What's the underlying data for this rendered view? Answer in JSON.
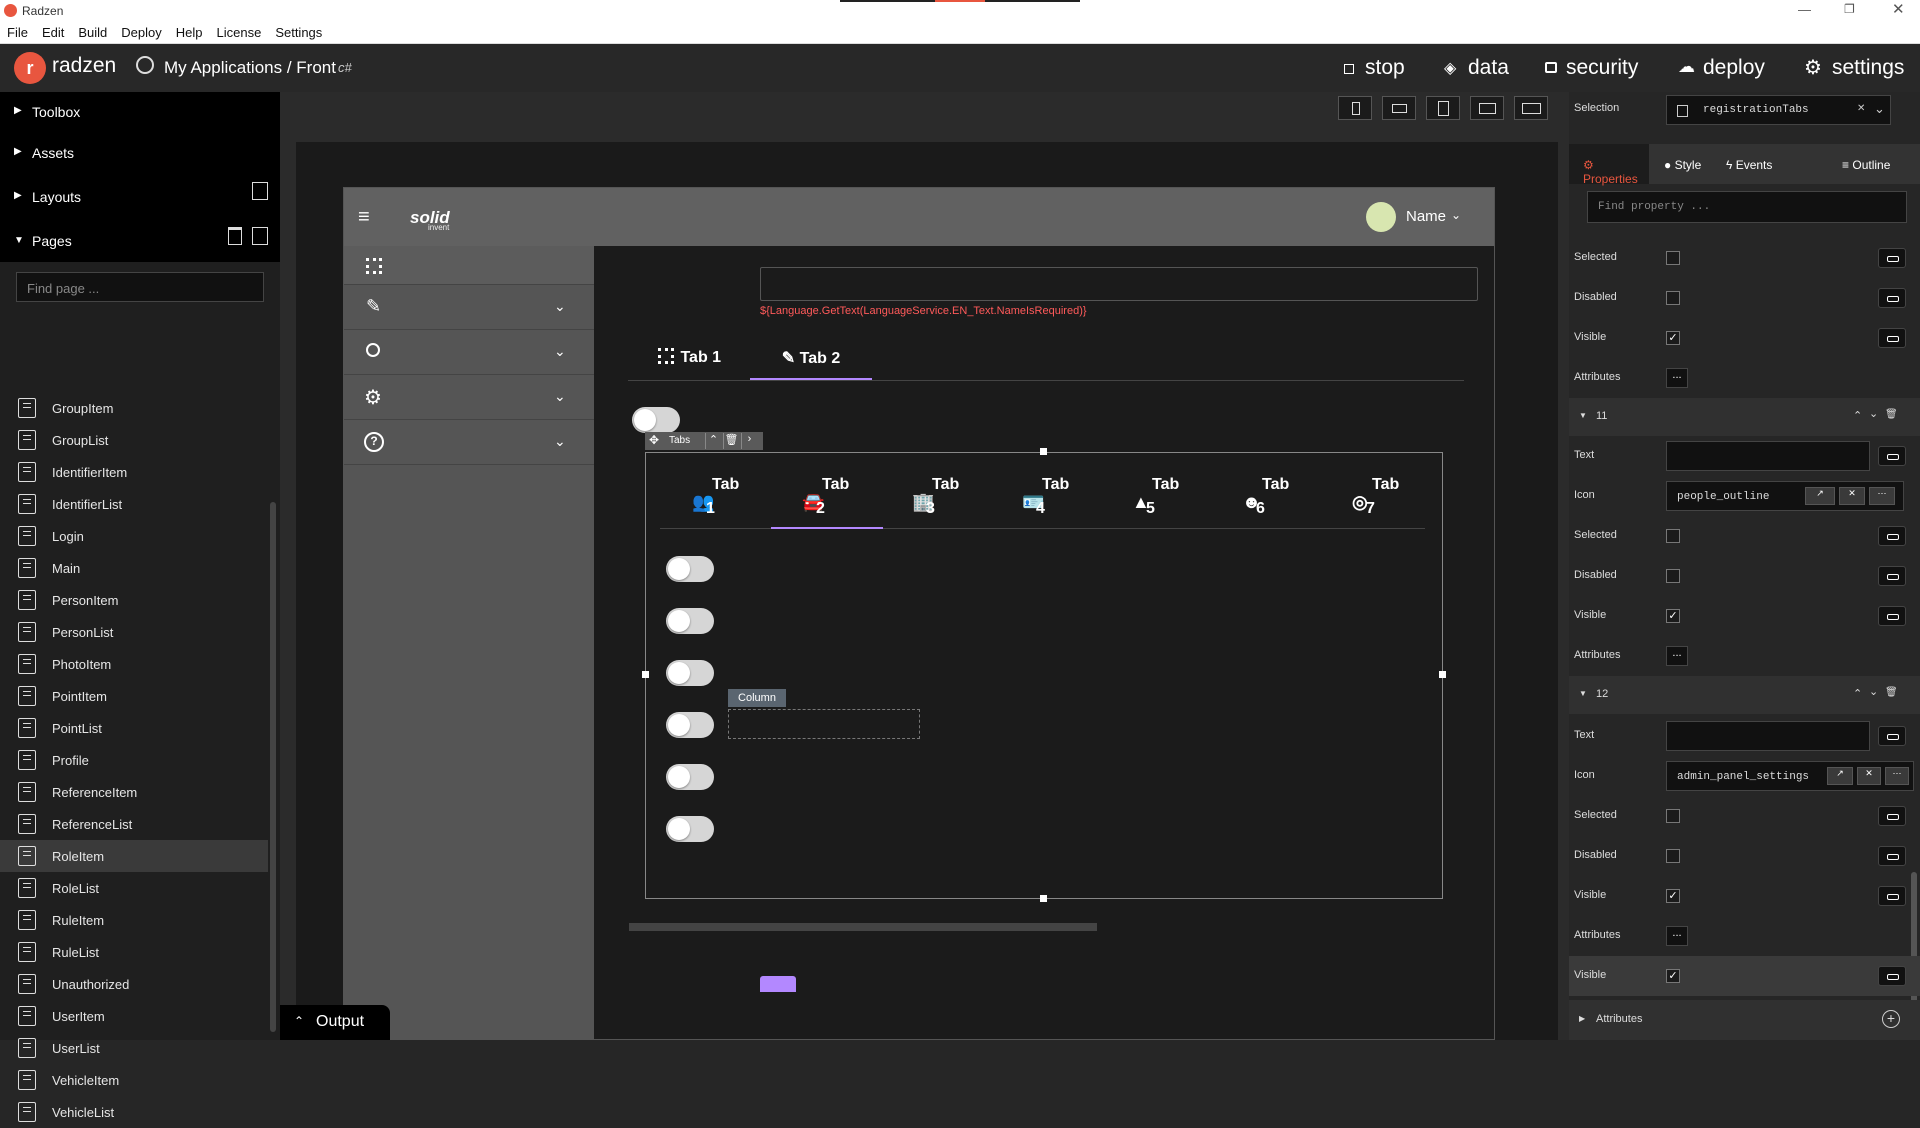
{
  "window": {
    "title": "Radzen"
  },
  "menu": [
    "File",
    "Edit",
    "Build",
    "Deploy",
    "Help",
    "License",
    "Settings"
  ],
  "header": {
    "logo_text": "radzen",
    "breadcrumb": "My Applications / Front",
    "breadcrumb_suffix": "c#",
    "actions": {
      "stop": "stop",
      "data": "data",
      "security": "security",
      "deploy": "deploy",
      "settings": "settings"
    }
  },
  "left": {
    "toolbox": "Toolbox",
    "assets": "Assets",
    "layouts": "Layouts",
    "pages": "Pages",
    "find_placeholder": "Find page ...",
    "page_list": [
      "GroupItem",
      "GroupList",
      "IdentifierItem",
      "IdentifierList",
      "Login",
      "Main",
      "PersonItem",
      "PersonList",
      "PhotoItem",
      "PointItem",
      "PointList",
      "Profile",
      "ReferenceItem",
      "ReferenceList",
      "RoleItem",
      "RoleList",
      "RuleItem",
      "RuleList",
      "Unauthorized",
      "UserItem",
      "UserList",
      "VehicleItem",
      "VehicleList"
    ],
    "selected_page": "RoleItem"
  },
  "canvas": {
    "app_logo": "solid",
    "app_logo_sub": "invent",
    "user_name": "Name",
    "error_text": "${Language.GetText(LanguageService.EN_Text.NameIsRequired)}",
    "outer_tabs": [
      "Tab 1",
      "Tab 2"
    ],
    "selection_label": "Tabs",
    "inner_tab_word": "Tab",
    "inner_tab_numbers": [
      "1",
      "2",
      "3",
      "4",
      "5",
      "6",
      "7"
    ],
    "column_label": "Column",
    "output_label": "Output"
  },
  "right": {
    "selection_label": "Selection",
    "selection_value": "registrationTabs",
    "tabs": [
      "Properties",
      "Style",
      "Events",
      "Outline"
    ],
    "find_placeholder": "Find property ...",
    "labels": {
      "selected": "Selected",
      "disabled": "Disabled",
      "visible": "Visible",
      "attributes": "Attributes",
      "text": "Text",
      "icon": "Icon"
    },
    "section_11": "11",
    "section_12": "12",
    "icon_11": "people_outline",
    "icon_12": "admin_panel_settings",
    "bottom_visible": "Visible",
    "bottom_attributes": "Attributes",
    "ellipsis": "..."
  },
  "colors": {
    "accent": "#e8563f",
    "purple": "#b388ff",
    "error": "#ff5a5a"
  }
}
